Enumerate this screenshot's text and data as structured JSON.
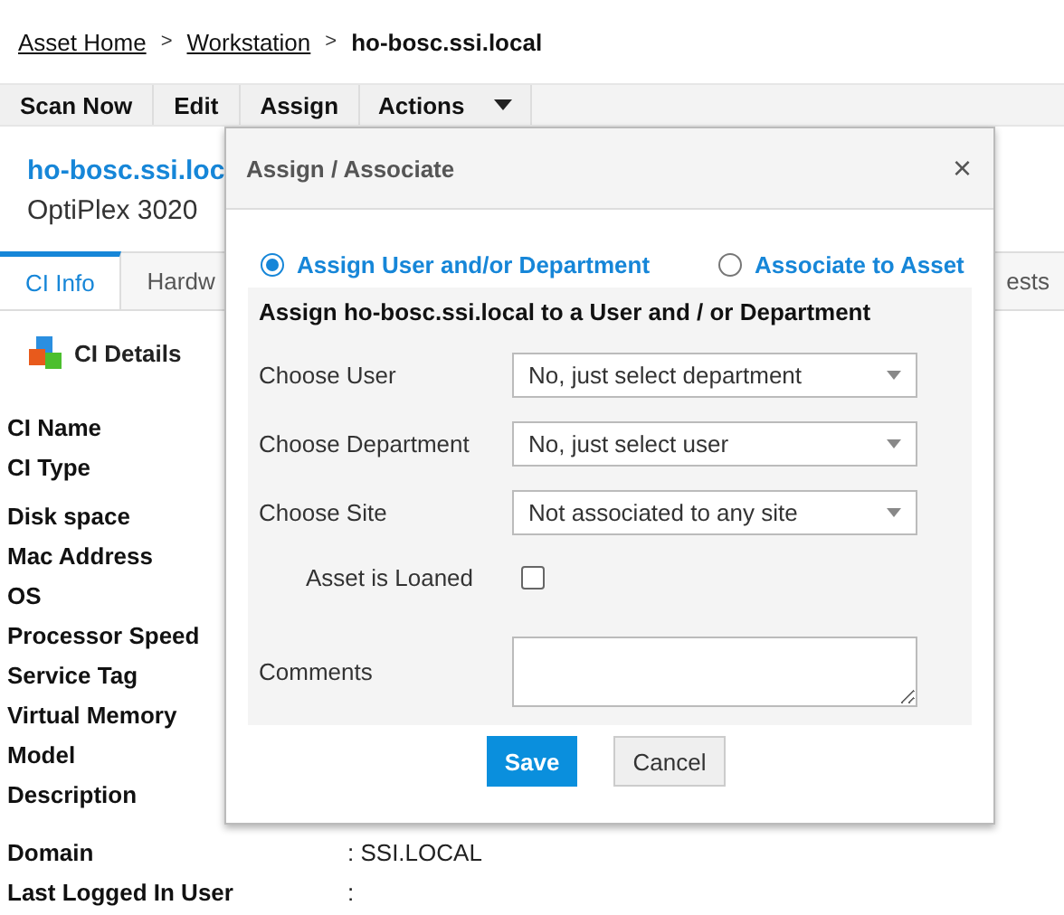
{
  "breadcrumb": [
    {
      "label": "Asset Home",
      "kind": "link",
      "separator": ">"
    },
    {
      "label": "Workstation",
      "kind": "link",
      "separator": ">"
    },
    {
      "label": "ho-bosc.ssi.local",
      "kind": "current"
    }
  ],
  "toolbar": [
    {
      "label": "Scan Now",
      "kind": "button"
    },
    {
      "label": "Edit",
      "kind": "button"
    },
    {
      "label": "Assign",
      "kind": "button"
    },
    {
      "label": "Actions",
      "kind": "menu"
    }
  ],
  "asset": {
    "name": "ho-bosc.ssi.loc",
    "model": "OptiPlex 3020"
  },
  "tabs": [
    {
      "label": "CI Info",
      "selected": true
    },
    {
      "label": "Hardw",
      "selected": false
    },
    {
      "label": "ests",
      "selected": false
    }
  ],
  "section_title": "CI Details",
  "field_groups": [
    [
      {
        "label": "CI Name"
      },
      {
        "label": "CI Type"
      }
    ],
    [
      {
        "label": "Disk space"
      },
      {
        "label": "Mac Address"
      },
      {
        "label": "OS"
      },
      {
        "label": "Processor Speed"
      },
      {
        "label": "Service Tag"
      },
      {
        "label": "Virtual Memory"
      },
      {
        "label": "Model"
      },
      {
        "label": "Description"
      }
    ],
    [
      {
        "label": "Domain",
        "value": ": SSI.LOCAL"
      },
      {
        "label": "Last Logged In User",
        "value": ":"
      }
    ]
  ],
  "dialog": {
    "title": "Assign / Associate",
    "close": "×",
    "options": [
      {
        "label": "Assign User and/or Department",
        "selected": true
      },
      {
        "label": "Associate to Asset",
        "selected": false
      }
    ],
    "heading": "Assign ho-bosc.ssi.local to a User and / or Department",
    "selects": [
      {
        "label": "Choose User",
        "value": "No, just select department"
      },
      {
        "label": "Choose Department",
        "value": "No, just select user"
      },
      {
        "label": "Choose Site",
        "value": "Not associated to any site"
      }
    ],
    "loaned": {
      "label": "Asset is Loaned",
      "checked": false
    },
    "comments": {
      "label": "Comments"
    },
    "buttons": [
      {
        "label": "Save",
        "kind": "primary"
      },
      {
        "label": "Cancel",
        "kind": "secondary"
      }
    ]
  }
}
